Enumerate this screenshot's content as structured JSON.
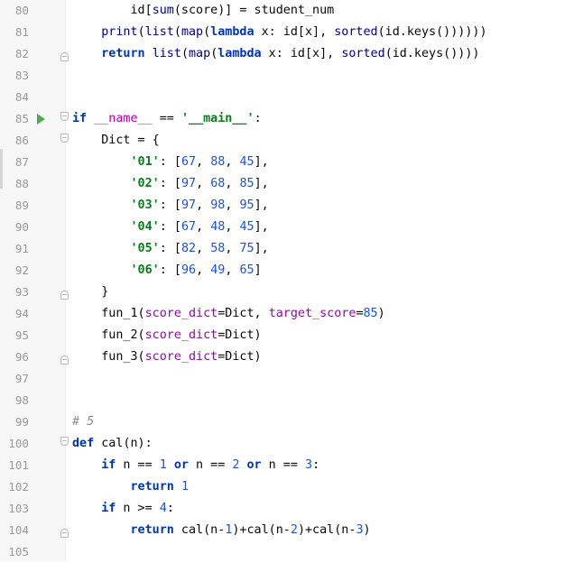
{
  "editor": {
    "first_line": 80,
    "run_line": 85,
    "fold_open_lines": [
      85,
      86,
      100
    ],
    "fold_end_lines": [
      82,
      93,
      96,
      104
    ],
    "colors": {
      "keyword": "#0033b3",
      "builtin": "#000080",
      "string": "#067d17",
      "number": "#1750eb",
      "parameter": "#871094",
      "comment": "#8c8c8c",
      "dunder": "#b200b2",
      "run_icon": "#4cae4c"
    },
    "lines": [
      {
        "num": "80",
        "tokens": [
          [
            "t",
            "        id["
          ],
          [
            "b",
            "sum"
          ],
          [
            "t",
            "(score)] = student_num"
          ]
        ]
      },
      {
        "num": "81",
        "tokens": [
          [
            "t",
            "    "
          ],
          [
            "b",
            "print"
          ],
          [
            "t",
            "("
          ],
          [
            "b",
            "list"
          ],
          [
            "t",
            "("
          ],
          [
            "b",
            "map"
          ],
          [
            "t",
            "("
          ],
          [
            "k",
            "lambda"
          ],
          [
            "t",
            " x: id[x], "
          ],
          [
            "b",
            "sorted"
          ],
          [
            "t",
            "(id.keys())))))"
          ]
        ]
      },
      {
        "num": "82",
        "tokens": [
          [
            "t",
            "    "
          ],
          [
            "k",
            "return"
          ],
          [
            "t",
            " "
          ],
          [
            "b",
            "list"
          ],
          [
            "t",
            "("
          ],
          [
            "b",
            "map"
          ],
          [
            "t",
            "("
          ],
          [
            "k",
            "lambda"
          ],
          [
            "t",
            " x: id[x], "
          ],
          [
            "b",
            "sorted"
          ],
          [
            "t",
            "(id.keys())))"
          ]
        ]
      },
      {
        "num": "83",
        "tokens": []
      },
      {
        "num": "84",
        "tokens": []
      },
      {
        "num": "85",
        "tokens": [
          [
            "k",
            "if"
          ],
          [
            "t",
            " __name__ == "
          ],
          [
            "s",
            "'__main__'"
          ],
          [
            "t",
            ":"
          ]
        ]
      },
      {
        "num": "86",
        "tokens": [
          [
            "t",
            "    Dict = {"
          ]
        ]
      },
      {
        "num": "87",
        "tokens": [
          [
            "t",
            "        "
          ],
          [
            "s",
            "'01'"
          ],
          [
            "t",
            ": ["
          ],
          [
            "n",
            "67"
          ],
          [
            "t",
            ", "
          ],
          [
            "n",
            "88"
          ],
          [
            "t",
            ", "
          ],
          [
            "n",
            "45"
          ],
          [
            "t",
            "],"
          ]
        ]
      },
      {
        "num": "88",
        "tokens": [
          [
            "t",
            "        "
          ],
          [
            "s",
            "'02'"
          ],
          [
            "t",
            ": ["
          ],
          [
            "n",
            "97"
          ],
          [
            "t",
            ", "
          ],
          [
            "n",
            "68"
          ],
          [
            "t",
            ", "
          ],
          [
            "n",
            "85"
          ],
          [
            "t",
            "],"
          ]
        ]
      },
      {
        "num": "89",
        "tokens": [
          [
            "t",
            "        "
          ],
          [
            "s",
            "'03'"
          ],
          [
            "t",
            ": ["
          ],
          [
            "n",
            "97"
          ],
          [
            "t",
            ", "
          ],
          [
            "n",
            "98"
          ],
          [
            "t",
            ", "
          ],
          [
            "n",
            "95"
          ],
          [
            "t",
            "],"
          ]
        ]
      },
      {
        "num": "90",
        "tokens": [
          [
            "t",
            "        "
          ],
          [
            "s",
            "'04'"
          ],
          [
            "t",
            ": ["
          ],
          [
            "n",
            "67"
          ],
          [
            "t",
            ", "
          ],
          [
            "n",
            "48"
          ],
          [
            "t",
            ", "
          ],
          [
            "n",
            "45"
          ],
          [
            "t",
            "],"
          ]
        ]
      },
      {
        "num": "91",
        "tokens": [
          [
            "t",
            "        "
          ],
          [
            "s",
            "'05'"
          ],
          [
            "t",
            ": ["
          ],
          [
            "n",
            "82"
          ],
          [
            "t",
            ", "
          ],
          [
            "n",
            "58"
          ],
          [
            "t",
            ", "
          ],
          [
            "n",
            "75"
          ],
          [
            "t",
            "],"
          ]
        ]
      },
      {
        "num": "92",
        "tokens": [
          [
            "t",
            "        "
          ],
          [
            "s",
            "'06'"
          ],
          [
            "t",
            ": ["
          ],
          [
            "n",
            "96"
          ],
          [
            "t",
            ", "
          ],
          [
            "n",
            "49"
          ],
          [
            "t",
            ", "
          ],
          [
            "n",
            "65"
          ],
          [
            "t",
            "]"
          ]
        ]
      },
      {
        "num": "93",
        "tokens": [
          [
            "t",
            "    }"
          ]
        ]
      },
      {
        "num": "94",
        "tokens": [
          [
            "t",
            "    fun_1("
          ],
          [
            "p",
            "score_dict"
          ],
          [
            "t",
            "=Dict, "
          ],
          [
            "p",
            "target_score"
          ],
          [
            "t",
            "="
          ],
          [
            "n",
            "85"
          ],
          [
            "t",
            ")"
          ]
        ]
      },
      {
        "num": "95",
        "tokens": [
          [
            "t",
            "    fun_2("
          ],
          [
            "p",
            "score_dict"
          ],
          [
            "t",
            "=Dict)"
          ]
        ]
      },
      {
        "num": "96",
        "tokens": [
          [
            "t",
            "    fun_3("
          ],
          [
            "p",
            "score_dict"
          ],
          [
            "t",
            "=Dict)"
          ]
        ]
      },
      {
        "num": "97",
        "tokens": []
      },
      {
        "num": "98",
        "tokens": []
      },
      {
        "num": "99",
        "tokens": [
          [
            "c",
            "# 5"
          ]
        ]
      },
      {
        "num": "100",
        "tokens": [
          [
            "k",
            "def"
          ],
          [
            "t",
            " cal(n):"
          ]
        ]
      },
      {
        "num": "101",
        "tokens": [
          [
            "t",
            "    "
          ],
          [
            "k",
            "if"
          ],
          [
            "t",
            " n == "
          ],
          [
            "n",
            "1"
          ],
          [
            "t",
            " "
          ],
          [
            "k",
            "or"
          ],
          [
            "t",
            " n == "
          ],
          [
            "n",
            "2"
          ],
          [
            "t",
            " "
          ],
          [
            "k",
            "or"
          ],
          [
            "t",
            " n == "
          ],
          [
            "n",
            "3"
          ],
          [
            "t",
            ":"
          ]
        ]
      },
      {
        "num": "102",
        "tokens": [
          [
            "t",
            "        "
          ],
          [
            "k",
            "return"
          ],
          [
            "t",
            " "
          ],
          [
            "n",
            "1"
          ]
        ]
      },
      {
        "num": "103",
        "tokens": [
          [
            "t",
            "    "
          ],
          [
            "k",
            "if"
          ],
          [
            "t",
            " n >= "
          ],
          [
            "n",
            "4"
          ],
          [
            "t",
            ":"
          ]
        ]
      },
      {
        "num": "104",
        "tokens": [
          [
            "t",
            "        "
          ],
          [
            "k",
            "return"
          ],
          [
            "t",
            " cal(n-"
          ],
          [
            "n",
            "1"
          ],
          [
            "t",
            ")+cal(n-"
          ],
          [
            "n",
            "2"
          ],
          [
            "t",
            ")+cal(n-"
          ],
          [
            "n",
            "3"
          ],
          [
            "t",
            ")"
          ]
        ]
      },
      {
        "num": "105",
        "tokens": []
      }
    ]
  }
}
